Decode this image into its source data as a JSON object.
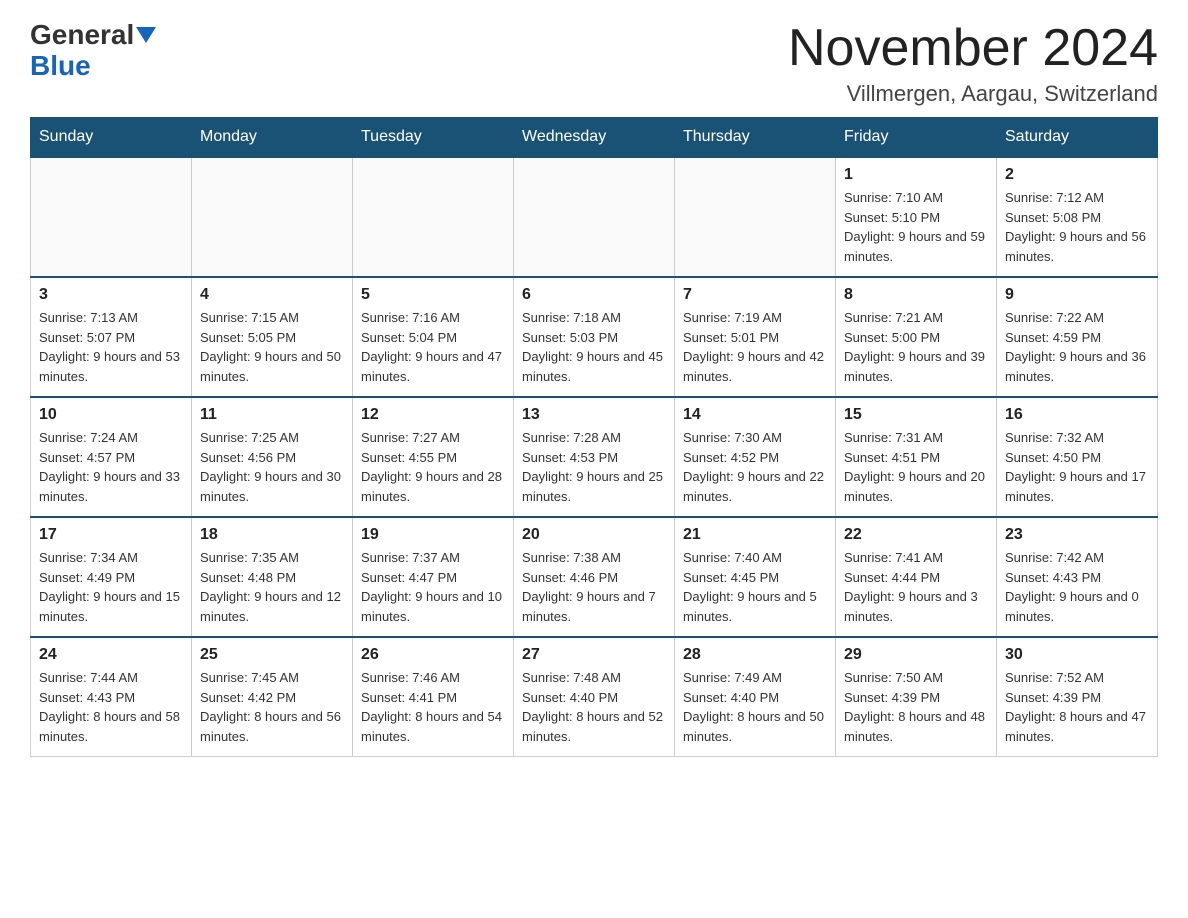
{
  "logo": {
    "general": "General",
    "blue": "Blue",
    "triangle_aria": "triangle icon"
  },
  "title": "November 2024",
  "subtitle": "Villmergen, Aargau, Switzerland",
  "days_of_week": [
    "Sunday",
    "Monday",
    "Tuesday",
    "Wednesday",
    "Thursday",
    "Friday",
    "Saturday"
  ],
  "weeks": [
    [
      {
        "day": "",
        "info": ""
      },
      {
        "day": "",
        "info": ""
      },
      {
        "day": "",
        "info": ""
      },
      {
        "day": "",
        "info": ""
      },
      {
        "day": "",
        "info": ""
      },
      {
        "day": "1",
        "info": "Sunrise: 7:10 AM\nSunset: 5:10 PM\nDaylight: 9 hours and 59 minutes."
      },
      {
        "day": "2",
        "info": "Sunrise: 7:12 AM\nSunset: 5:08 PM\nDaylight: 9 hours and 56 minutes."
      }
    ],
    [
      {
        "day": "3",
        "info": "Sunrise: 7:13 AM\nSunset: 5:07 PM\nDaylight: 9 hours and 53 minutes."
      },
      {
        "day": "4",
        "info": "Sunrise: 7:15 AM\nSunset: 5:05 PM\nDaylight: 9 hours and 50 minutes."
      },
      {
        "day": "5",
        "info": "Sunrise: 7:16 AM\nSunset: 5:04 PM\nDaylight: 9 hours and 47 minutes."
      },
      {
        "day": "6",
        "info": "Sunrise: 7:18 AM\nSunset: 5:03 PM\nDaylight: 9 hours and 45 minutes."
      },
      {
        "day": "7",
        "info": "Sunrise: 7:19 AM\nSunset: 5:01 PM\nDaylight: 9 hours and 42 minutes."
      },
      {
        "day": "8",
        "info": "Sunrise: 7:21 AM\nSunset: 5:00 PM\nDaylight: 9 hours and 39 minutes."
      },
      {
        "day": "9",
        "info": "Sunrise: 7:22 AM\nSunset: 4:59 PM\nDaylight: 9 hours and 36 minutes."
      }
    ],
    [
      {
        "day": "10",
        "info": "Sunrise: 7:24 AM\nSunset: 4:57 PM\nDaylight: 9 hours and 33 minutes."
      },
      {
        "day": "11",
        "info": "Sunrise: 7:25 AM\nSunset: 4:56 PM\nDaylight: 9 hours and 30 minutes."
      },
      {
        "day": "12",
        "info": "Sunrise: 7:27 AM\nSunset: 4:55 PM\nDaylight: 9 hours and 28 minutes."
      },
      {
        "day": "13",
        "info": "Sunrise: 7:28 AM\nSunset: 4:53 PM\nDaylight: 9 hours and 25 minutes."
      },
      {
        "day": "14",
        "info": "Sunrise: 7:30 AM\nSunset: 4:52 PM\nDaylight: 9 hours and 22 minutes."
      },
      {
        "day": "15",
        "info": "Sunrise: 7:31 AM\nSunset: 4:51 PM\nDaylight: 9 hours and 20 minutes."
      },
      {
        "day": "16",
        "info": "Sunrise: 7:32 AM\nSunset: 4:50 PM\nDaylight: 9 hours and 17 minutes."
      }
    ],
    [
      {
        "day": "17",
        "info": "Sunrise: 7:34 AM\nSunset: 4:49 PM\nDaylight: 9 hours and 15 minutes."
      },
      {
        "day": "18",
        "info": "Sunrise: 7:35 AM\nSunset: 4:48 PM\nDaylight: 9 hours and 12 minutes."
      },
      {
        "day": "19",
        "info": "Sunrise: 7:37 AM\nSunset: 4:47 PM\nDaylight: 9 hours and 10 minutes."
      },
      {
        "day": "20",
        "info": "Sunrise: 7:38 AM\nSunset: 4:46 PM\nDaylight: 9 hours and 7 minutes."
      },
      {
        "day": "21",
        "info": "Sunrise: 7:40 AM\nSunset: 4:45 PM\nDaylight: 9 hours and 5 minutes."
      },
      {
        "day": "22",
        "info": "Sunrise: 7:41 AM\nSunset: 4:44 PM\nDaylight: 9 hours and 3 minutes."
      },
      {
        "day": "23",
        "info": "Sunrise: 7:42 AM\nSunset: 4:43 PM\nDaylight: 9 hours and 0 minutes."
      }
    ],
    [
      {
        "day": "24",
        "info": "Sunrise: 7:44 AM\nSunset: 4:43 PM\nDaylight: 8 hours and 58 minutes."
      },
      {
        "day": "25",
        "info": "Sunrise: 7:45 AM\nSunset: 4:42 PM\nDaylight: 8 hours and 56 minutes."
      },
      {
        "day": "26",
        "info": "Sunrise: 7:46 AM\nSunset: 4:41 PM\nDaylight: 8 hours and 54 minutes."
      },
      {
        "day": "27",
        "info": "Sunrise: 7:48 AM\nSunset: 4:40 PM\nDaylight: 8 hours and 52 minutes."
      },
      {
        "day": "28",
        "info": "Sunrise: 7:49 AM\nSunset: 4:40 PM\nDaylight: 8 hours and 50 minutes."
      },
      {
        "day": "29",
        "info": "Sunrise: 7:50 AM\nSunset: 4:39 PM\nDaylight: 8 hours and 48 minutes."
      },
      {
        "day": "30",
        "info": "Sunrise: 7:52 AM\nSunset: 4:39 PM\nDaylight: 8 hours and 47 minutes."
      }
    ]
  ]
}
